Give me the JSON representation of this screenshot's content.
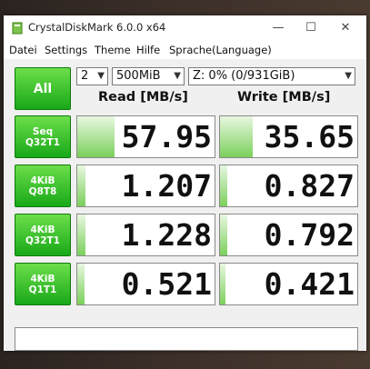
{
  "window": {
    "title": "CrystalDiskMark 6.0.0 x64"
  },
  "titlebar_buttons": {
    "minimize": "—",
    "maximize": "☐",
    "close": "✕"
  },
  "menu": [
    "Datei",
    "Settings",
    "Theme",
    "Hilfe",
    "Sprache(Language)"
  ],
  "controls": {
    "all_label": "All",
    "count": "2",
    "size": "500MiB",
    "drive": "Z: 0% (0/931GiB)",
    "dropdown_icon": "chevron-down-icon"
  },
  "headers": {
    "read": "Read [MB/s]",
    "write": "Write [MB/s]"
  },
  "tests": [
    {
      "line1": "Seq",
      "line2": "Q32T1",
      "read": "57.95",
      "write": "35.65",
      "read_fill": 0.27,
      "write_fill": 0.24
    },
    {
      "line1": "4KiB",
      "line2": "Q8T8",
      "read": "1.207",
      "write": "0.827",
      "read_fill": 0.06,
      "write_fill": 0.05
    },
    {
      "line1": "4KiB",
      "line2": "Q32T1",
      "read": "1.228",
      "write": "0.792",
      "read_fill": 0.06,
      "write_fill": 0.05
    },
    {
      "line1": "4KiB",
      "line2": "Q1T1",
      "read": "0.521",
      "write": "0.421",
      "read_fill": 0.05,
      "write_fill": 0.04
    }
  ],
  "comment": "",
  "colors": {
    "button_green_top": "#6cde4a",
    "button_green_bottom": "#18a818",
    "bar_green": "#7bd05c"
  }
}
